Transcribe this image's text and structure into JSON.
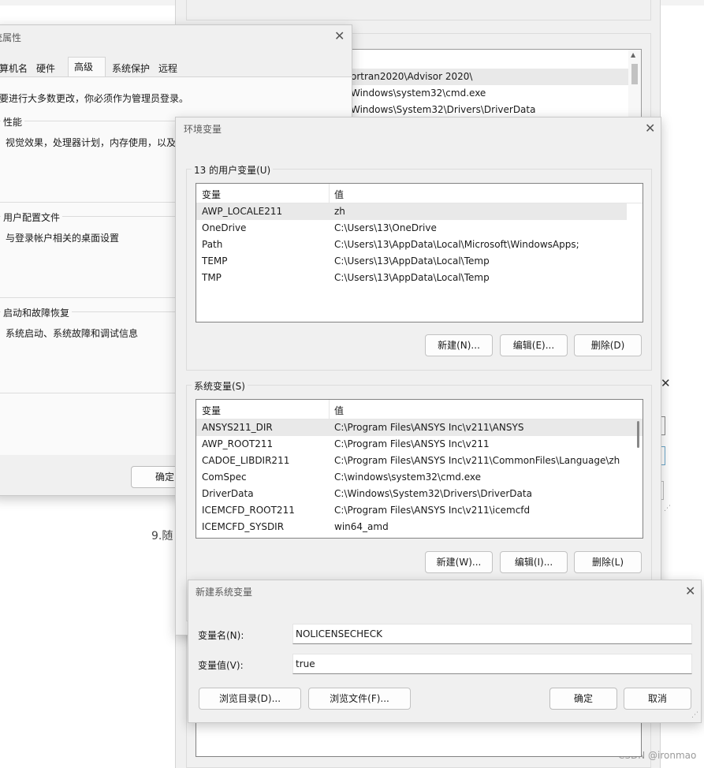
{
  "background": {
    "bottom_text": "9.随",
    "watermark": "CSDN @ironmao",
    "path_rows": [
      "ortran2020\\Advisor 2020\\",
      "Windows\\system32\\cmd.exe",
      "Windows\\System32\\Drivers\\DriverData"
    ]
  },
  "sysprops": {
    "title": "统属性",
    "tabs": [
      "算机名",
      "硬件",
      "高级",
      "系统保护",
      "远程"
    ],
    "note": "要进行大多数更改，你必须作为管理员登录。",
    "performance": {
      "label": "性能",
      "desc": "视觉效果，处理器计划，内存使用，以及"
    },
    "profile": {
      "label": "用户配置文件",
      "desc": "与登录帐户相关的桌面设置"
    },
    "startup": {
      "label": "启动和故障恢复",
      "desc": "系统启动、系统故障和调试信息"
    },
    "ok": "确定"
  },
  "envvars": {
    "title": "环境变量",
    "user_group": "13 的用户变量(U)",
    "system_group": "系统变量(S)",
    "col_var": "变量",
    "col_val": "值",
    "user_vars": [
      {
        "name": "AWP_LOCALE211",
        "value": "zh"
      },
      {
        "name": "OneDrive",
        "value": "C:\\Users\\13\\OneDrive"
      },
      {
        "name": "Path",
        "value": "C:\\Users\\13\\AppData\\Local\\Microsoft\\WindowsApps;"
      },
      {
        "name": "TEMP",
        "value": "C:\\Users\\13\\AppData\\Local\\Temp"
      },
      {
        "name": "TMP",
        "value": "C:\\Users\\13\\AppData\\Local\\Temp"
      }
    ],
    "system_vars": [
      {
        "name": "ANSYS211_DIR",
        "value": "C:\\Program Files\\ANSYS Inc\\v211\\ANSYS"
      },
      {
        "name": "AWP_ROOT211",
        "value": "C:\\Program Files\\ANSYS Inc\\v211"
      },
      {
        "name": "CADOE_LIBDIR211",
        "value": "C:\\Program Files\\ANSYS Inc\\v211\\CommonFiles\\Language\\zh"
      },
      {
        "name": "ComSpec",
        "value": "C:\\windows\\system32\\cmd.exe"
      },
      {
        "name": "DriverData",
        "value": "C:\\Windows\\System32\\Drivers\\DriverData"
      },
      {
        "name": "ICEMCFD_ROOT211",
        "value": "C:\\Program Files\\ANSYS Inc\\v211\\icemcfd"
      },
      {
        "name": "ICEMCFD_SYSDIR",
        "value": "win64_amd"
      }
    ],
    "user_buttons": {
      "new": "新建(N)...",
      "edit": "编辑(E)...",
      "delete": "删除(D)"
    },
    "system_buttons": {
      "new": "新建(W)...",
      "edit": "编辑(I)...",
      "delete": "删除(L)"
    }
  },
  "newvar": {
    "title": "新建系统变量",
    "name_label": "变量名(N):",
    "name_value": "NOLICENSECHECK",
    "value_label": "变量值(V):",
    "value_value": "true",
    "browse_dir": "浏览目录(D)...",
    "browse_file": "浏览文件(F)...",
    "ok": "确定",
    "cancel": "取消"
  }
}
